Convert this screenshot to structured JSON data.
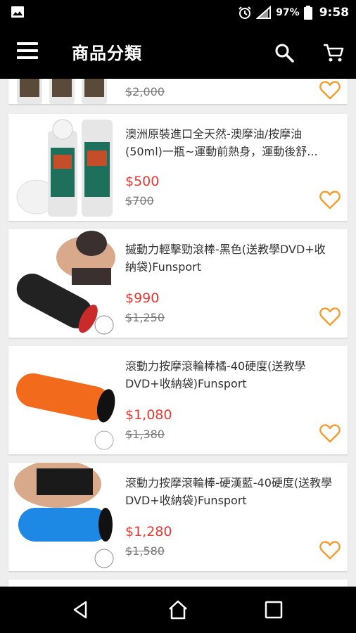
{
  "status_bar": {
    "battery_percent": "97%",
    "time": "9:58",
    "icons": [
      "image-notification-icon",
      "alarm-icon",
      "signal-icon",
      "battery-icon"
    ]
  },
  "app_bar": {
    "title": "商品分類",
    "icons": [
      "menu-icon",
      "search-icon",
      "cart-icon"
    ]
  },
  "products": [
    {
      "name": "",
      "price": "",
      "original_price": "$2,000"
    },
    {
      "name": "澳洲原裝進口全天然-澳摩油/按摩油(50ml)一瓶~運動前熱身，運動後舒...",
      "price": "$500",
      "original_price": "$700"
    },
    {
      "name": "摵動力輕擊勁滾棒-黑色(送教學DVD+收納袋)Funsport",
      "price": "$990",
      "original_price": "$1,250"
    },
    {
      "name": "滾動力按摩滾輪棒橘-40硬度(送教學DVD+收納袋)Funsport",
      "price": "$1,080",
      "original_price": "$1,380"
    },
    {
      "name": "滾動力按摩滾輪棒-硬漢藍-40硬度(送教學DVD+收納袋)Funsport",
      "price": "$1,280",
      "original_price": "$1,580"
    }
  ],
  "nav_bar": {
    "icons": [
      "back-icon",
      "home-icon",
      "recents-icon"
    ]
  },
  "colors": {
    "price": "#e53935",
    "favorite": "#f39c2d",
    "bar": "#000000",
    "background": "#eeeeee"
  }
}
